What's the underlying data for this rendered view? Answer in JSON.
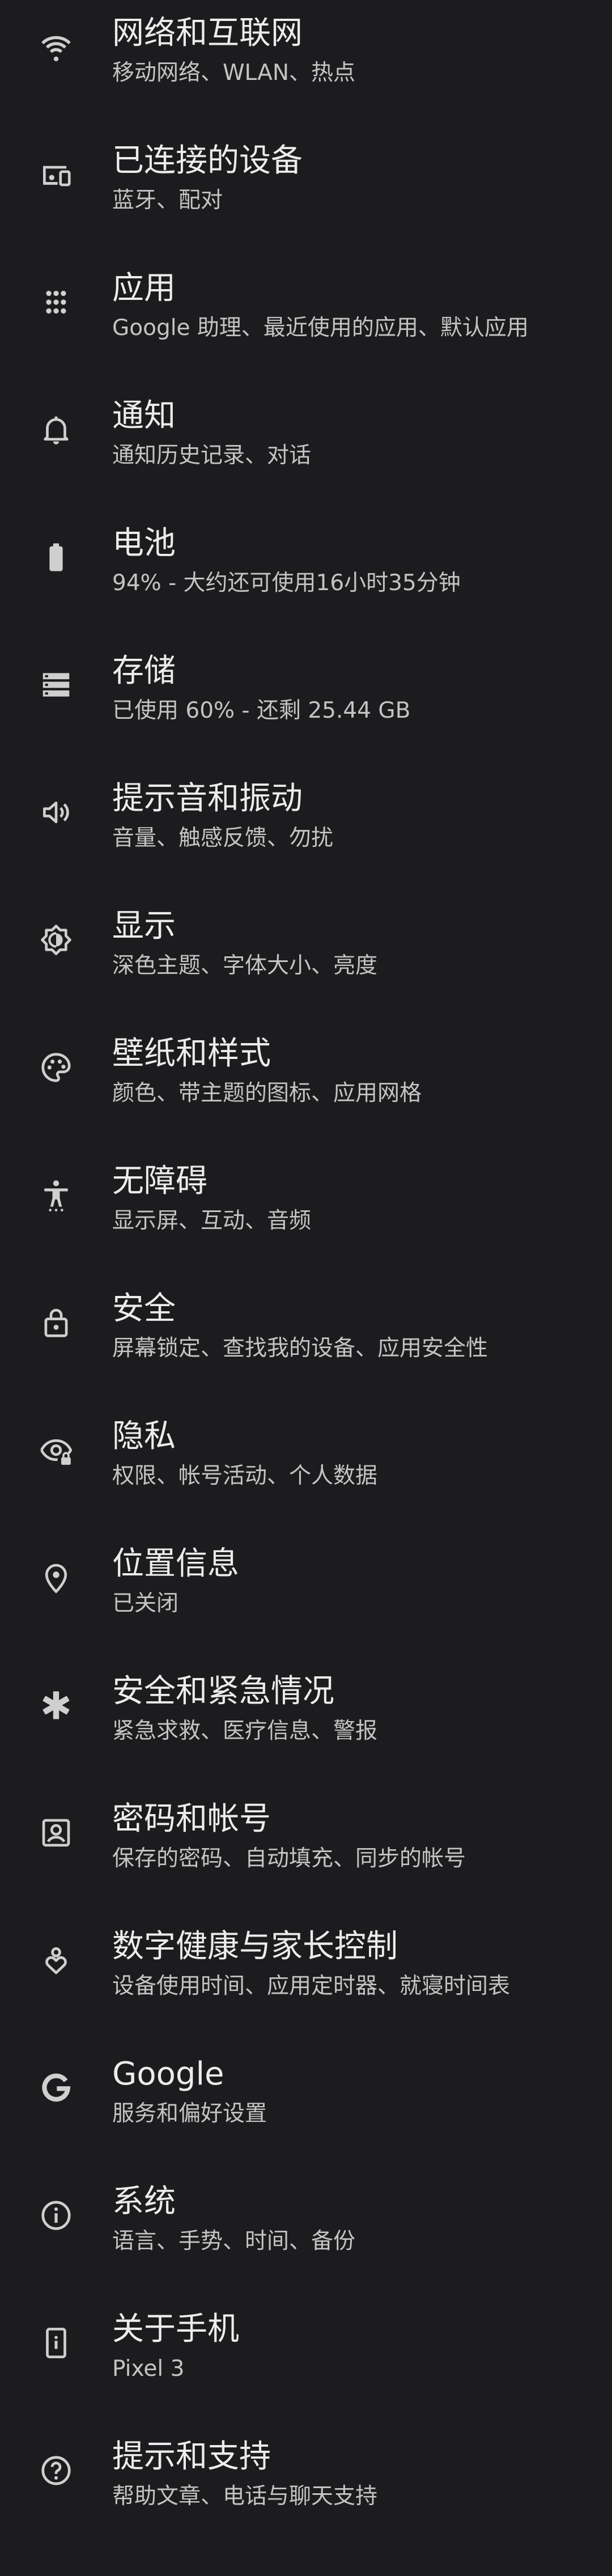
{
  "settings": {
    "items": [
      {
        "icon": "wifi-icon",
        "title": "网络和互联网",
        "subtitle": "移动网络、WLAN、热点"
      },
      {
        "icon": "connected-devices-icon",
        "title": "已连接的设备",
        "subtitle": "蓝牙、配对"
      },
      {
        "icon": "apps-grid-icon",
        "title": "应用",
        "subtitle": "Google 助理、最近使用的应用、默认应用"
      },
      {
        "icon": "bell-icon",
        "title": "通知",
        "subtitle": "通知历史记录、对话"
      },
      {
        "icon": "battery-icon",
        "title": "电池",
        "subtitle": "94% - 大约还可使用16小时35分钟"
      },
      {
        "icon": "storage-icon",
        "title": "存储",
        "subtitle": "已使用 60% - 还剩 25.44 GB"
      },
      {
        "icon": "volume-icon",
        "title": "提示音和振动",
        "subtitle": "音量、触感反馈、勿扰"
      },
      {
        "icon": "brightness-icon",
        "title": "显示",
        "subtitle": "深色主题、字体大小、亮度"
      },
      {
        "icon": "palette-icon",
        "title": "壁纸和样式",
        "subtitle": "颜色、带主题的图标、应用网格"
      },
      {
        "icon": "accessibility-icon",
        "title": "无障碍",
        "subtitle": "显示屏、互动、音频"
      },
      {
        "icon": "lock-icon",
        "title": "安全",
        "subtitle": "屏幕锁定、查找我的设备、应用安全性"
      },
      {
        "icon": "privacy-eye-icon",
        "title": "隐私",
        "subtitle": "权限、帐号活动、个人数据"
      },
      {
        "icon": "location-pin-icon",
        "title": "位置信息",
        "subtitle": "已关闭"
      },
      {
        "icon": "emergency-asterisk-icon",
        "title": "安全和紧急情况",
        "subtitle": "紧急求救、医疗信息、警报"
      },
      {
        "icon": "account-box-icon",
        "title": "密码和帐号",
        "subtitle": "保存的密码、自动填充、同步的帐号"
      },
      {
        "icon": "digital-wellbeing-icon",
        "title": "数字健康与家长控制",
        "subtitle": "设备使用时间、应用定时器、就寝时间表"
      },
      {
        "icon": "google-g-icon",
        "title": "Google",
        "subtitle": "服务和偏好设置"
      },
      {
        "icon": "info-icon",
        "title": "系统",
        "subtitle": "语言、手势、时间、备份"
      },
      {
        "icon": "phone-info-icon",
        "title": "关于手机",
        "subtitle": "Pixel 3"
      },
      {
        "icon": "help-icon",
        "title": "提示和支持",
        "subtitle": "帮助文章、电话与聊天支持"
      }
    ]
  }
}
